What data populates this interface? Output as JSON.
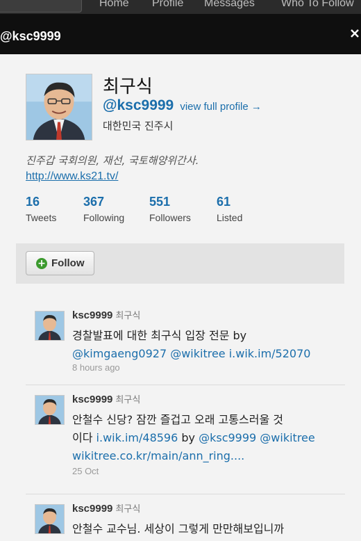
{
  "nav": {
    "items": [
      "Home",
      "Profile",
      "Messages",
      "Who To Follow"
    ]
  },
  "dialog": {
    "title": "@ksc9999"
  },
  "profile": {
    "name": "최구식",
    "handle": "@ksc9999",
    "view_full_profile": "view full profile →",
    "location": "대한민국 진주시",
    "bio": "진주갑 국회의원, 재선, 국토해양위간사.",
    "url": "http://www.ks21.tv/",
    "stats": [
      {
        "value": "16",
        "label": "Tweets"
      },
      {
        "value": "367",
        "label": "Following"
      },
      {
        "value": "551",
        "label": "Followers"
      },
      {
        "value": "61",
        "label": "Listed"
      }
    ]
  },
  "follow_button": {
    "label": "Follow"
  },
  "tweets": [
    {
      "user": "ksc9999",
      "name": "최구식",
      "text_plain": "경찰발표에 대한 최구식 입장 전문 by",
      "mentions": "@kimgaeng0927 @wikitree i.wik.im/52070",
      "time": "8 hours ago"
    },
    {
      "user": "ksc9999",
      "name": "최구식",
      "line1": "안철수 신당? 잠깐 즐겁고 오래 고통스러울 것",
      "line2_plain": "이다",
      "line2_link": "i.wik.im/48596",
      "line2_by": "by",
      "line2_mentions": "@ksc9999 @wikitree",
      "line3": "wikitree.co.kr/main/ann_ring....",
      "time": "25 Oct"
    },
    {
      "user": "ksc9999",
      "name": "최구식",
      "line1": "안철수 교수님. 세상이 그렇게 만만해보입니까"
    }
  ],
  "colors": {
    "link": "#1b6eab",
    "header_bg": "#0f0f0f",
    "nav_bg": "#2b2b2b",
    "follow_green": "#3c9a2e"
  }
}
